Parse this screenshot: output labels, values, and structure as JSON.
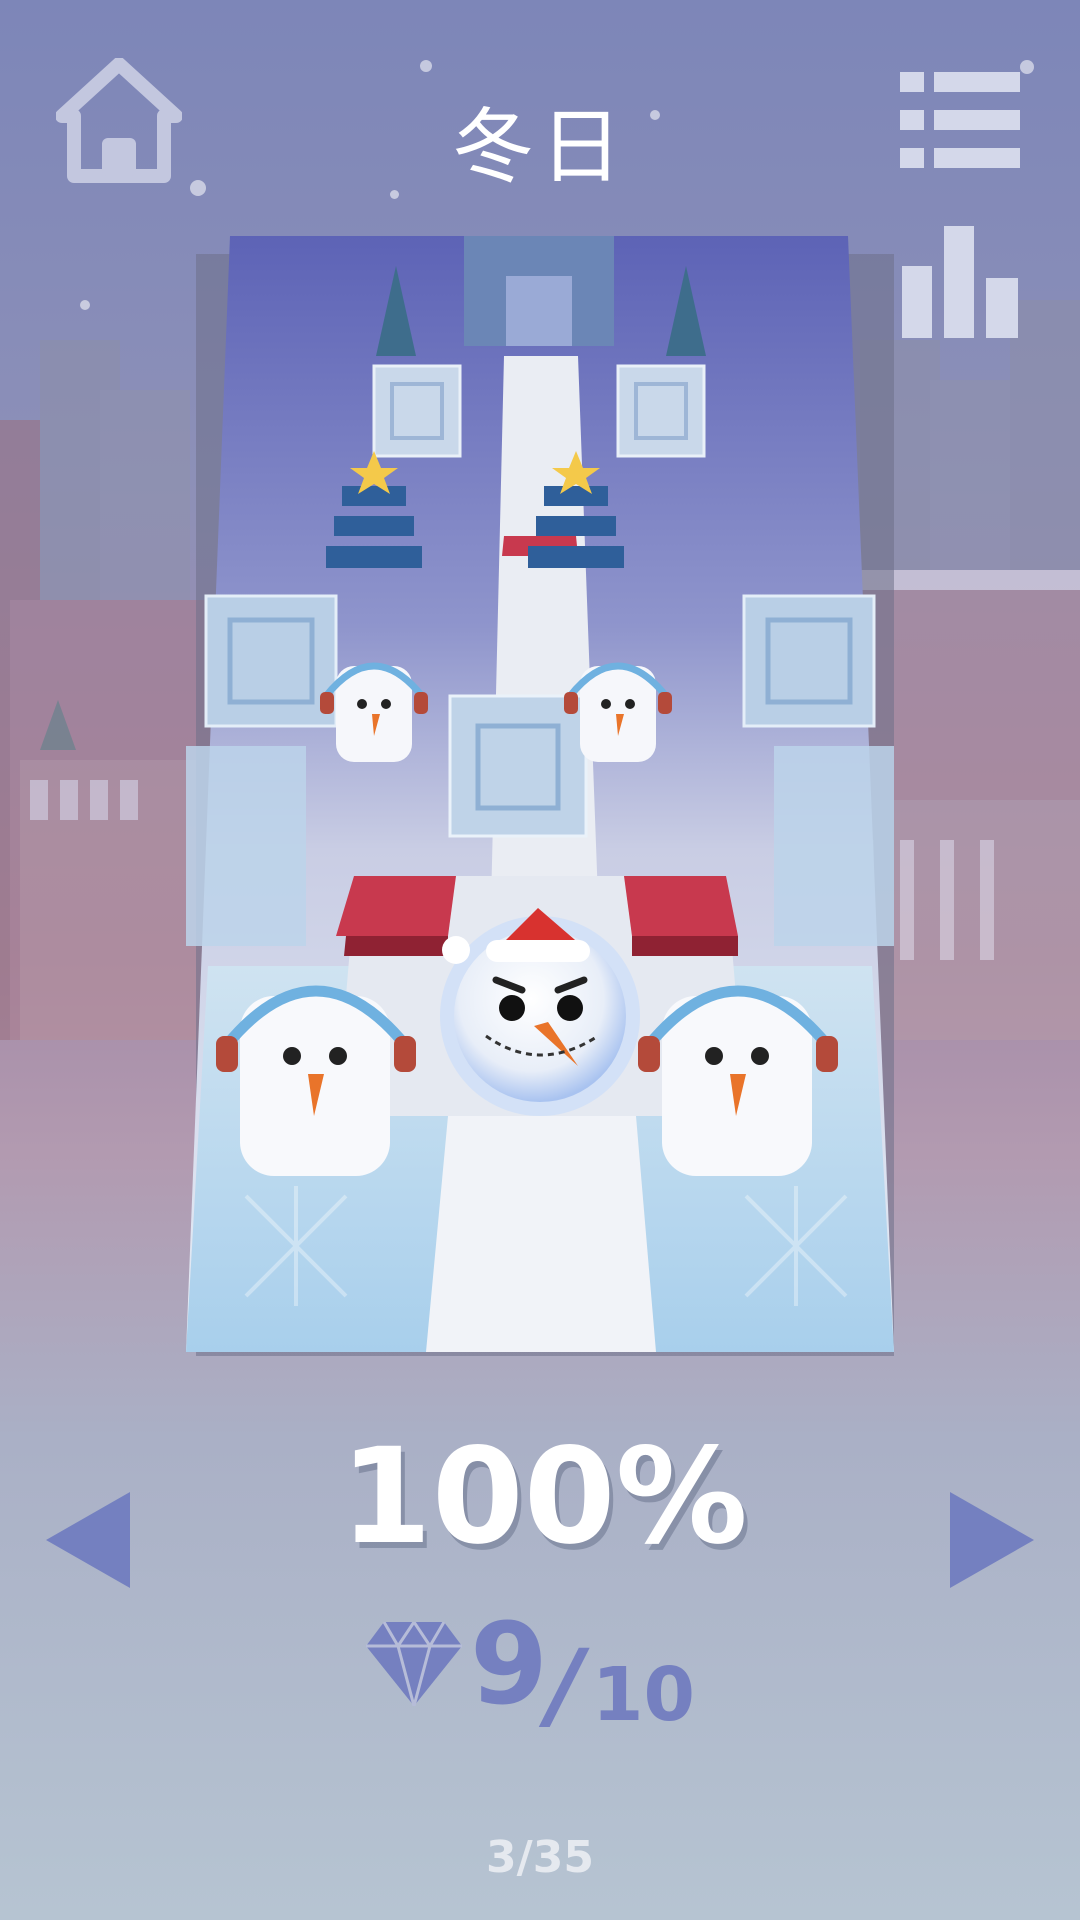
{
  "level": {
    "title": "冬日",
    "progress": "100%",
    "gems_collected": "9",
    "gems_separator": "/",
    "gems_total": "10",
    "page_index": "3/35"
  },
  "icons": {
    "home": "home-icon",
    "menu": "list-menu-icon",
    "stats": "bar-chart-icon",
    "prev": "triangle-left-icon",
    "next": "triangle-right-icon",
    "gem": "diamond-icon"
  },
  "colors": {
    "accent": "#7580c0",
    "icon_light": "#d4d8ea",
    "tile_red": "#c8394e"
  }
}
